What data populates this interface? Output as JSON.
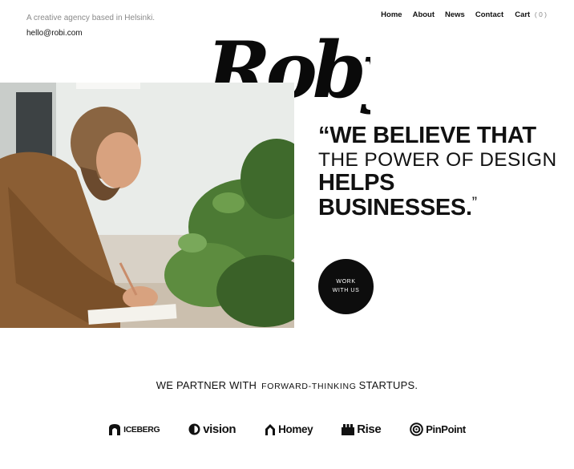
{
  "header": {
    "tagline": "A creative agency based in Helsinki.",
    "email": "hello@robi.com"
  },
  "nav": {
    "items": [
      {
        "label": "Home"
      },
      {
        "label": "About"
      },
      {
        "label": "News"
      },
      {
        "label": "Contact"
      }
    ],
    "cart_label": "Cart",
    "cart_count": "( 0 )"
  },
  "logo": {
    "text": "Roby"
  },
  "hero": {
    "quote": {
      "line1": "“We believe that",
      "line2": "the power of design",
      "line3": "helps",
      "line4": "businesses.",
      "closing": "”"
    },
    "cta_label": "Work with us"
  },
  "partners": {
    "heading_part1": "We partner with",
    "heading_part2": "Forward-thinking",
    "heading_part3": "startups.",
    "brands": [
      {
        "name": "ICEBERG",
        "icon": "iceberg-icon"
      },
      {
        "name": "vision",
        "icon": "vision-icon"
      },
      {
        "name": "Homey",
        "icon": "homey-icon"
      },
      {
        "name": "Rise",
        "icon": "rise-icon"
      },
      {
        "name": "PinPoint",
        "icon": "pinpoint-icon"
      }
    ]
  },
  "colors": {
    "background": "#ffffff",
    "text": "#111111",
    "muted": "#8a8a8a",
    "cta_background": "#0d0d0d"
  }
}
